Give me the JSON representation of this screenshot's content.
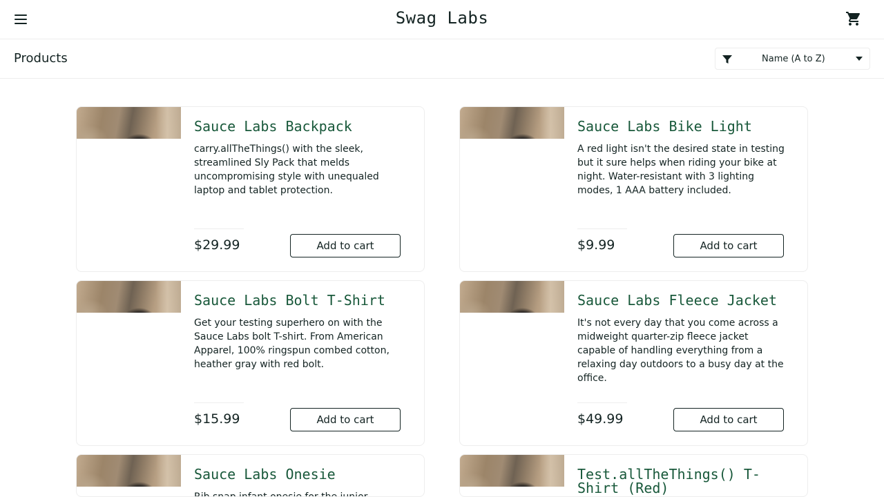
{
  "header": {
    "logo": "Swag Labs"
  },
  "subheader": {
    "title": "Products",
    "sort": {
      "selected": "Name (A to Z)"
    }
  },
  "icons": {
    "menu": "hamburger-menu-icon",
    "cart": "shopping-cart-icon",
    "filter": "filter-funnel-icon",
    "caret": "caret-down-icon"
  },
  "colors": {
    "title_green": "#18583a",
    "text_dark": "#132322",
    "border": "#ededed"
  },
  "products": [
    {
      "name": "Sauce Labs Backpack",
      "description": "carry.allTheThings() with the sleek, streamlined Sly Pack that melds uncompromising style with unequaled laptop and tablet protection.",
      "price": "$29.99",
      "button": "Add to cart"
    },
    {
      "name": "Sauce Labs Bike Light",
      "description": "A red light isn't the desired state in testing but it sure helps when riding your bike at night. Water-resistant with 3 lighting modes, 1 AAA battery included.",
      "price": "$9.99",
      "button": "Add to cart"
    },
    {
      "name": "Sauce Labs Bolt T-Shirt",
      "description": "Get your testing superhero on with the Sauce Labs bolt T-shirt. From American Apparel, 100% ringspun combed cotton, heather gray with red bolt.",
      "price": "$15.99",
      "button": "Add to cart"
    },
    {
      "name": "Sauce Labs Fleece Jacket",
      "description": "It's not every day that you come across a midweight quarter-zip fleece jacket capable of handling everything from a relaxing day outdoors to a busy day at the office.",
      "price": "$49.99",
      "button": "Add to cart"
    },
    {
      "name": "Sauce Labs Onesie",
      "description": "Rib snap infant onesie for the junior",
      "price": "",
      "button": ""
    },
    {
      "name": "Test.allTheThings() T-Shirt (Red)",
      "description": "",
      "price": "",
      "button": ""
    }
  ]
}
